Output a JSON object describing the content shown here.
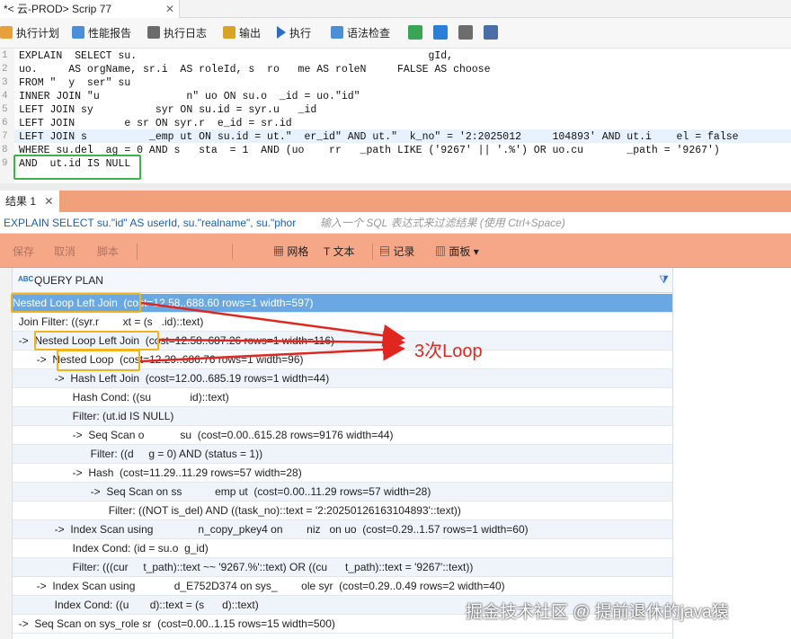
{
  "window_tab": {
    "title": "*<  云-PROD> Scrip   77",
    "close": "✕"
  },
  "toolbar": {
    "items": [
      "执行计划",
      "性能报告",
      "执行日志",
      "输出",
      "执行",
      "语法检查"
    ],
    "accent": "#2c6cc2"
  },
  "editor": {
    "lines": [
      {
        "n": "1",
        "text": "EXPLAIN  SELECT su.                                               gId,"
      },
      {
        "n": "2",
        "text": "uo.     AS orgName, sr.i  AS roleId, s  ro   me AS roleN     FALSE AS choose"
      },
      {
        "n": "3",
        "text": "FROM \"  y  ser\" su"
      },
      {
        "n": "4",
        "text": "INNER JOIN \"u              n\" uo ON su.o  _id = uo.\"id\""
      },
      {
        "n": "5",
        "text": "LEFT JOIN sy          syr ON su.id = syr.u   _id"
      },
      {
        "n": "6",
        "text": "LEFT JOIN        e sr ON syr.r  e_id = sr.id"
      },
      {
        "n": "7",
        "text": "LEFT JOIN s          _emp ut ON su.id = ut.\"  er_id\" AND ut.\"  k_no\" = '2:2025012     104893' AND ut.i    el = false"
      },
      {
        "n": "8",
        "text": "WHERE su.del  ag = 0 AND s   sta  = 1  AND (uo    rr   _path LIKE ('9267' || '.%') OR uo.cu       _path = '9267')"
      },
      {
        "n": "9",
        "text": "AND  ut.id IS NULL"
      }
    ]
  },
  "results_tab": {
    "label": "结果 1",
    "close": "✕"
  },
  "filter": {
    "sql": "EXPLAIN SELECT su.\"id\" AS userId, su.\"realname\", su.\"phor",
    "placeholder": "输入一个 SQL 表达式来过滤结果 (使用 Ctrl+Space)"
  },
  "result_toolbar": {
    "save": "保存",
    "cancel": "取消",
    "script": "脚本",
    "grid": "网格",
    "text": "文本",
    "record": "记录",
    "panel": "面板"
  },
  "grid": {
    "column": "QUERY PLAN",
    "rows": [
      "Nested Loop Left Join  (cost=12.58..688.60 rows=1 width=597)",
      "  Join Filter: ((syr.r        xt = (s   .id)::text)",
      "  ->  Nested Loop Left Join  (cost=12.58..687.26 rows=1 width=116)",
      "        ->  Nested Loop  (cost=12.29..686.76 rows=1 width=96)",
      "              ->  Hash Left Join  (cost=12.00..685.19 rows=1 width=44)",
      "                    Hash Cond: ((su             id)::text)",
      "                    Filter: (ut.id IS NULL)",
      "                    ->  Seq Scan o            su  (cost=0.00..615.28 rows=9176 width=44)",
      "                          Filter: ((d     g = 0) AND (status = 1))",
      "                    ->  Hash  (cost=11.29..11.29 rows=57 width=28)",
      "                          ->  Seq Scan on ss           emp ut  (cost=0.00..11.29 rows=57 width=28)",
      "                                Filter: ((NOT is_del) AND ((task_no)::text = '2:20250126163104893'::text))",
      "              ->  Index Scan using               n_copy_pkey4 on        niz   on uo  (cost=0.29..1.57 rows=1 width=60)",
      "                    Index Cond: (id = su.o  g_id)",
      "                    Filter: (((cur     t_path)::text ~~ '9267.%'::text) OR ((cu      t_path)::text = '9267'::text))",
      "        ->  Index Scan using             d_E752D374 on sys_        ole syr  (cost=0.29..0.49 rows=2 width=40)",
      "              Index Cond: ((u       d)::text = (s      d)::text)",
      "  ->  Seq Scan on sys_role sr  (cost=0.00..1.15 rows=15 width=500)"
    ]
  },
  "annotation": {
    "label": "3次Loop",
    "color": "#e0271f"
  },
  "watermark": "掘金技术社区 @ 提前退休的java猿"
}
